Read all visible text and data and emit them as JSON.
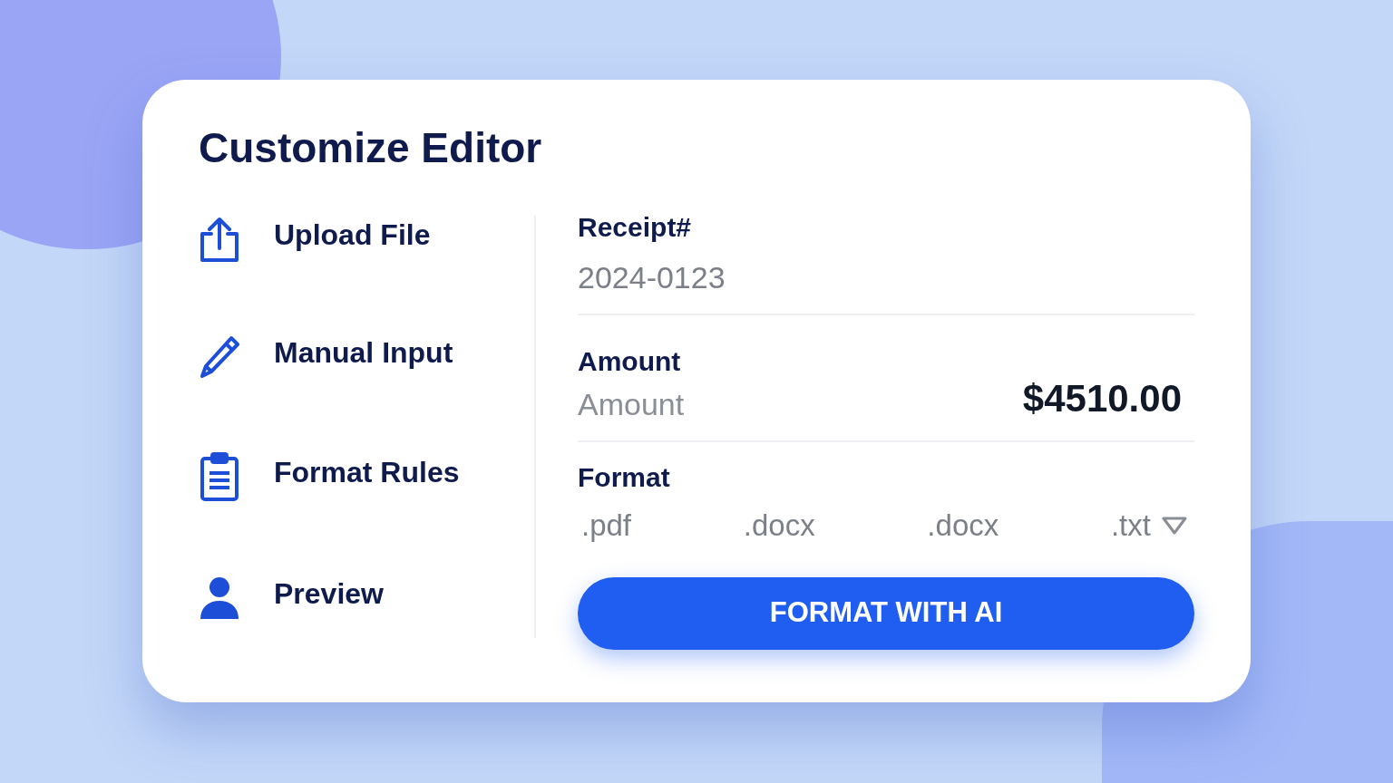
{
  "title": "Customize Editor",
  "menu": [
    {
      "kind": "upload",
      "label": "Upload File"
    },
    {
      "kind": "pencil",
      "label": "Manual Input"
    },
    {
      "kind": "clipboard",
      "label": "Format Rules"
    },
    {
      "kind": "person",
      "label": "Preview"
    }
  ],
  "receipt": {
    "label": "Receipt#",
    "value": "2024-0123"
  },
  "amount": {
    "label": "Amount",
    "placeholder": "Amount",
    "value": "$4510.00"
  },
  "format": {
    "label": "Format",
    "options": [
      ".pdf",
      ".docx",
      ".docx",
      ".txt"
    ]
  },
  "button": "FORMAT WITH AI"
}
